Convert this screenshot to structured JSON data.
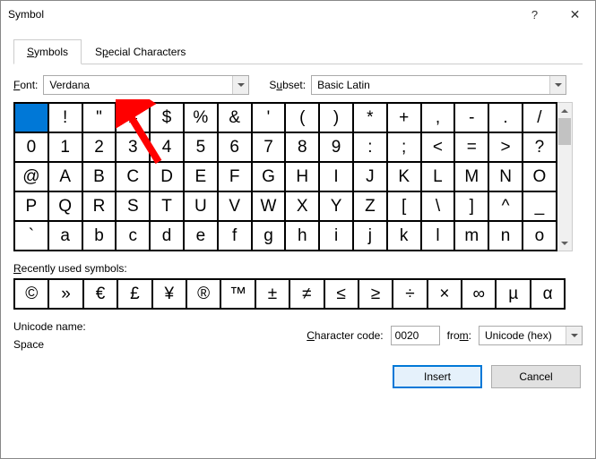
{
  "title": "Symbol",
  "tabs": {
    "symbols": "Symbols",
    "special": "Special Characters"
  },
  "font_label": "Font:",
  "font_value": "Verdana",
  "subset_label": "Subset:",
  "subset_value": "Basic Latin",
  "grid": [
    [
      " ",
      "!",
      "\"",
      "#",
      "$",
      "%",
      "&",
      "'",
      "(",
      ")",
      "*",
      "+",
      ",",
      "-",
      ".",
      "/"
    ],
    [
      "0",
      "1",
      "2",
      "3",
      "4",
      "5",
      "6",
      "7",
      "8",
      "9",
      ":",
      ";",
      "<",
      "=",
      ">",
      "?"
    ],
    [
      "@",
      "A",
      "B",
      "C",
      "D",
      "E",
      "F",
      "G",
      "H",
      "I",
      "J",
      "K",
      "L",
      "M",
      "N",
      "O"
    ],
    [
      "P",
      "Q",
      "R",
      "S",
      "T",
      "U",
      "V",
      "W",
      "X",
      "Y",
      "Z",
      "[",
      "\\",
      "]",
      "^",
      "_"
    ],
    [
      "`",
      "a",
      "b",
      "c",
      "d",
      "e",
      "f",
      "g",
      "h",
      "i",
      "j",
      "k",
      "l",
      "m",
      "n",
      "o"
    ]
  ],
  "recent_label": "Recently used symbols:",
  "recent": [
    "©",
    "»",
    "€",
    "£",
    "¥",
    "®",
    "™",
    "±",
    "≠",
    "≤",
    "≥",
    "÷",
    "×",
    "∞",
    "µ",
    "α"
  ],
  "unicode_name_label": "Unicode name:",
  "unicode_name_value": "Space",
  "char_code_label": "Character code:",
  "char_code_value": "0020",
  "from_label": "from:",
  "from_value": "Unicode (hex)",
  "insert": "Insert",
  "cancel": "Cancel"
}
